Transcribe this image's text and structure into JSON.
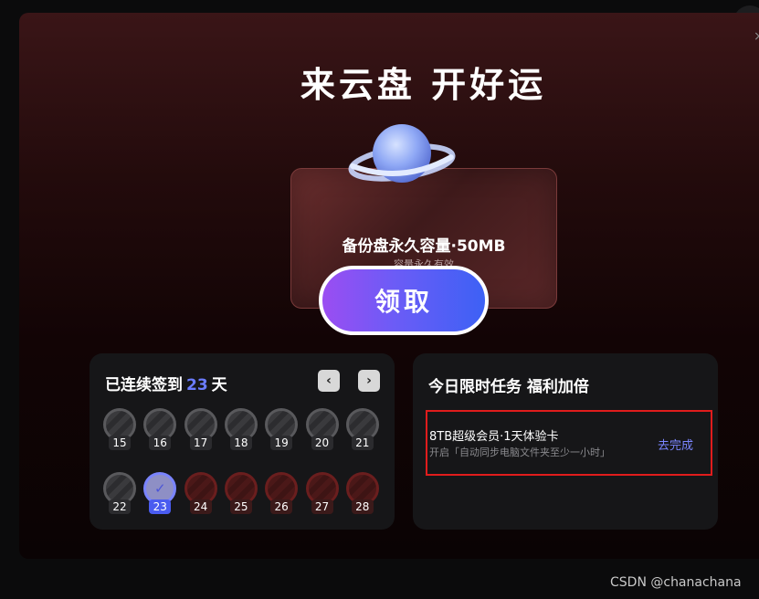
{
  "title": "来云盘 开好运",
  "prize": {
    "name": "备份盘永久容量·50MB",
    "subtitle": "容量永久有效",
    "claim_label": "领取"
  },
  "checkin": {
    "prefix": "已连续签到",
    "days": "23",
    "suffix": "天",
    "prev_icon": "chevron-left-icon",
    "next_icon": "chevron-right-icon",
    "prev_glyph": "‹",
    "next_glyph": "›",
    "day_list": [
      {
        "day": "15",
        "state": "past"
      },
      {
        "day": "16",
        "state": "past"
      },
      {
        "day": "17",
        "state": "past"
      },
      {
        "day": "18",
        "state": "past"
      },
      {
        "day": "19",
        "state": "past"
      },
      {
        "day": "20",
        "state": "past"
      },
      {
        "day": "21",
        "state": "past"
      },
      {
        "day": "22",
        "state": "past"
      },
      {
        "day": "23",
        "state": "today"
      },
      {
        "day": "24",
        "state": "future"
      },
      {
        "day": "25",
        "state": "future"
      },
      {
        "day": "26",
        "state": "future"
      },
      {
        "day": "27",
        "state": "future"
      },
      {
        "day": "28",
        "state": "future"
      }
    ],
    "check_glyph": "✓"
  },
  "tasks": {
    "title": "今日限时任务 福利加倍",
    "items": [
      {
        "name": "8TB超级会员·1天体验卡",
        "desc": "开启「自动同步电脑文件夹至少一小时」",
        "action": "去完成"
      }
    ]
  },
  "close_glyph": "×",
  "watermark": "CSDN @chanachana",
  "colors": {
    "accent": "#6b7cff",
    "highlight_border": "#e01c1c",
    "button_gradient_start": "#9b4df2",
    "button_gradient_end": "#3d61f5"
  }
}
